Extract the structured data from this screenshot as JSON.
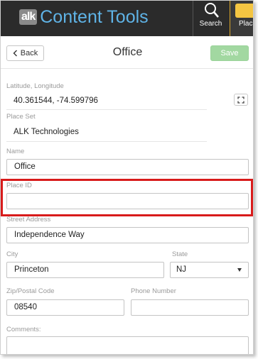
{
  "app": {
    "brand_mark": "alk",
    "title": "Content Tools",
    "nav": {
      "search_label": "Search",
      "places_label": "Plac"
    }
  },
  "header": {
    "back_label": "Back",
    "page_title": "Office",
    "save_label": "Save"
  },
  "form": {
    "latlong": {
      "label": "Latitude, Longitude",
      "value": "40.361544, -74.599796"
    },
    "place_set": {
      "label": "Place Set",
      "value": "ALK Technologies"
    },
    "name": {
      "label": "Name",
      "value": "Office"
    },
    "place_id": {
      "label": "Place ID",
      "value": ""
    },
    "street": {
      "label": "Street Address",
      "value": "Independence Way"
    },
    "city": {
      "label": "City",
      "value": "Princeton"
    },
    "state": {
      "label": "State",
      "value": "NJ"
    },
    "zip": {
      "label": "Zip/Postal Code",
      "value": "08540"
    },
    "phone": {
      "label": "Phone Number",
      "value": ""
    },
    "comments": {
      "label": "Comments:",
      "value": ""
    }
  },
  "colors": {
    "topbar": "#2b2b2b",
    "brand_blue": "#5fb3e6",
    "save_green": "#a2d8a1",
    "highlight_red": "#d81b1b"
  },
  "icons": [
    "search-icon",
    "places-icon",
    "chevron-left-icon",
    "expand-icon",
    "caret-down-icon"
  ]
}
